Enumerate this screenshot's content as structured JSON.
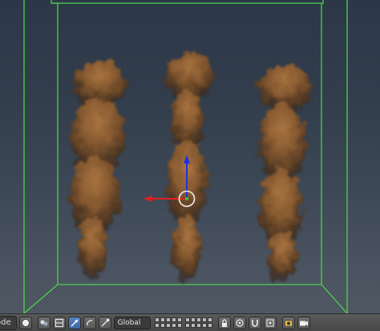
{
  "header": {
    "mode_label": "ode",
    "orientation_label": "Global"
  },
  "viewport": {
    "background_top": "#2c3748",
    "background_bottom": "#4f5762",
    "domain_color": "#4bd34b",
    "manipulator_x_color": "#e02020",
    "manipulator_z_color": "#2030e0",
    "smoke_color": "#8a5a2e"
  },
  "icons": [
    "shading-solid-icon",
    "pivot-icon",
    "manipulator-toggle-icon",
    "translate-icon",
    "rotate-icon",
    "scale-icon",
    "layers-grid",
    "lock-icon",
    "render-icon"
  ]
}
